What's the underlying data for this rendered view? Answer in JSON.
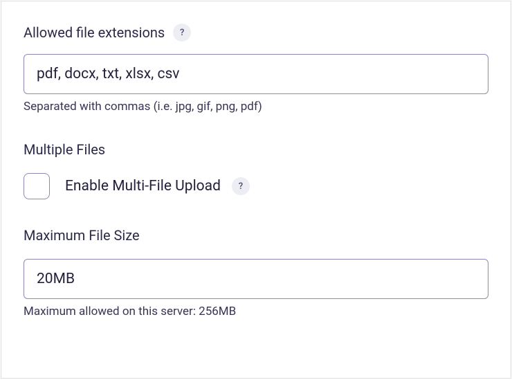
{
  "allowed_extensions": {
    "label": "Allowed file extensions",
    "help_icon": "?",
    "value": "pdf, docx, txt, xlsx, csv",
    "hint": "Separated with commas (i.e. jpg, gif, png, pdf)"
  },
  "multiple_files": {
    "heading": "Multiple Files",
    "checkbox_label": "Enable Multi-File Upload",
    "help_icon": "?",
    "checked": false
  },
  "max_file_size": {
    "heading": "Maximum File Size",
    "value": "20MB",
    "hint": "Maximum allowed on this server: 256MB"
  }
}
